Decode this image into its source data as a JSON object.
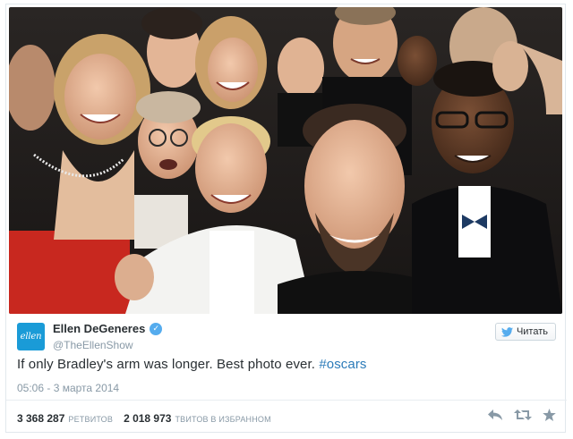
{
  "tweet": {
    "author_name": "Ellen DeGeneres",
    "author_handle": "@TheEllenShow",
    "avatar_text": "ellen",
    "follow_label": "Читать",
    "text": "If only Bradley's arm was longer. Best photo ever.",
    "hashtag": "#oscars",
    "timestamp": "05:06 - 3 марта 2014",
    "retweet_count": "3 368 287",
    "retweet_label": "РЕТВИТОВ",
    "favorite_count": "2 018 973",
    "favorite_label": "ТВИТОВ В ИЗБРАННОМ"
  },
  "icons": {
    "verified": "verified-badge-icon",
    "follow": "twitter-bird-icon",
    "reply": "reply-arrow-icon",
    "retweet": "retweet-icon",
    "favorite": "star-icon"
  },
  "colors": {
    "accent": "#55acee",
    "link": "#2b7bb9",
    "avatar_bg": "#1a9bd7",
    "text": "#292f33",
    "muted": "#8899a6"
  }
}
